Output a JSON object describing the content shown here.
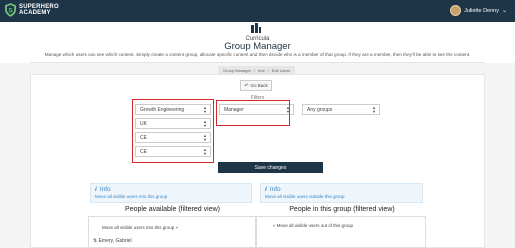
{
  "header": {
    "logo_line1": "SUPERHERO",
    "logo_line2": "ACADEMY",
    "user_name": "Juliette Denny",
    "caret": "⌄"
  },
  "page": {
    "subtitle": "Curricula",
    "title": "Group Manager",
    "description": "Manage which users can see which content. Simply create a content group, allocate specific content and then decide who is a member of that group. If they are a member, then they'll be able to see the content."
  },
  "breadcrumb": [
    "Group Manager",
    "test",
    "Edit Users"
  ],
  "go_back_label": "Go Back",
  "filters_label": "Filters",
  "filters": {
    "left": [
      "Growth Engineering",
      "UK",
      "CE",
      "CE"
    ],
    "middle": "Manager",
    "right": "Any groups"
  },
  "save_label": "Save changes",
  "info_left": {
    "title": "Info",
    "link": "Move all visible users into this group"
  },
  "info_right": {
    "title": "Info",
    "link": "Move all visible users outside this group"
  },
  "col_left_title": "People available (filtered view)",
  "col_right_title": "People in this group (filtered view)",
  "move_into": "Move all visible users into this group",
  "move_out": "Move all visible users out of this group",
  "users_available": [
    "Emery, Gabriel"
  ],
  "colors": {
    "navy": "#1e3447",
    "highlight": "#d12b2b",
    "info_blue": "#3a86c8"
  }
}
